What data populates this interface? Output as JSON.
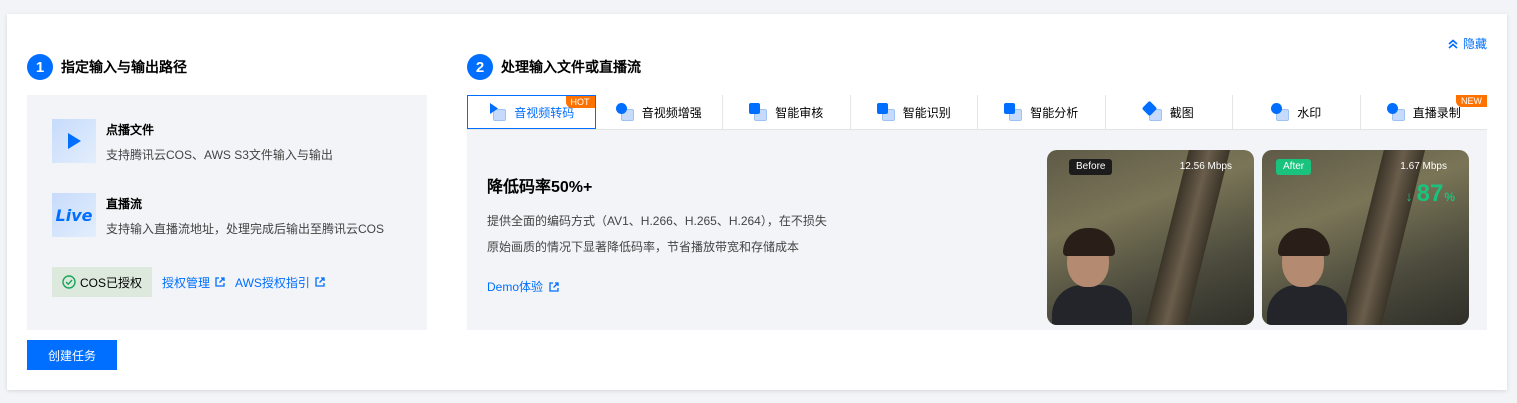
{
  "hide_label": "隐藏",
  "step1": {
    "num": "1",
    "title": "指定输入与输出路径"
  },
  "step2": {
    "num": "2",
    "title": "处理输入文件或直播流"
  },
  "sources": [
    {
      "icon": "play-icon",
      "title": "点播文件",
      "desc": "支持腾讯云COS、AWS S3文件输入与输出"
    },
    {
      "icon": "live-icon",
      "icon_text": "Live",
      "title": "直播流",
      "desc": "支持输入直播流地址，处理完成后输出至腾讯云COS"
    }
  ],
  "auth": {
    "cos_status": "COS已授权",
    "manage_link": "授权管理",
    "aws_link": "AWS授权指引"
  },
  "create_button": "创建任务",
  "tabs": [
    {
      "label": "音视频转码",
      "active": true,
      "badge": "HOT"
    },
    {
      "label": "音视频增强"
    },
    {
      "label": "智能审核"
    },
    {
      "label": "智能识别"
    },
    {
      "label": "智能分析"
    },
    {
      "label": "截图"
    },
    {
      "label": "水印"
    },
    {
      "label": "直播录制",
      "badge": "NEW"
    }
  ],
  "feature": {
    "title": "降低码率50%+",
    "desc_line1": "提供全面的编码方式（AV1、H.266、H.265、H.264），在不损失",
    "desc_line2": "原始画质的情况下显著降低码率，节省播放带宽和存储成本",
    "demo_link": "Demo体验"
  },
  "compare": {
    "before_label": "Before",
    "before_rate": "12.56 Mbps",
    "after_label": "After",
    "after_rate": "1.67 Mbps",
    "reduction_value": "87",
    "reduction_unit": "%",
    "reduction_arrow": "↓"
  },
  "colors": {
    "accent": "#006eff",
    "success": "#19c37d",
    "hot_badge": "#ff7200"
  }
}
